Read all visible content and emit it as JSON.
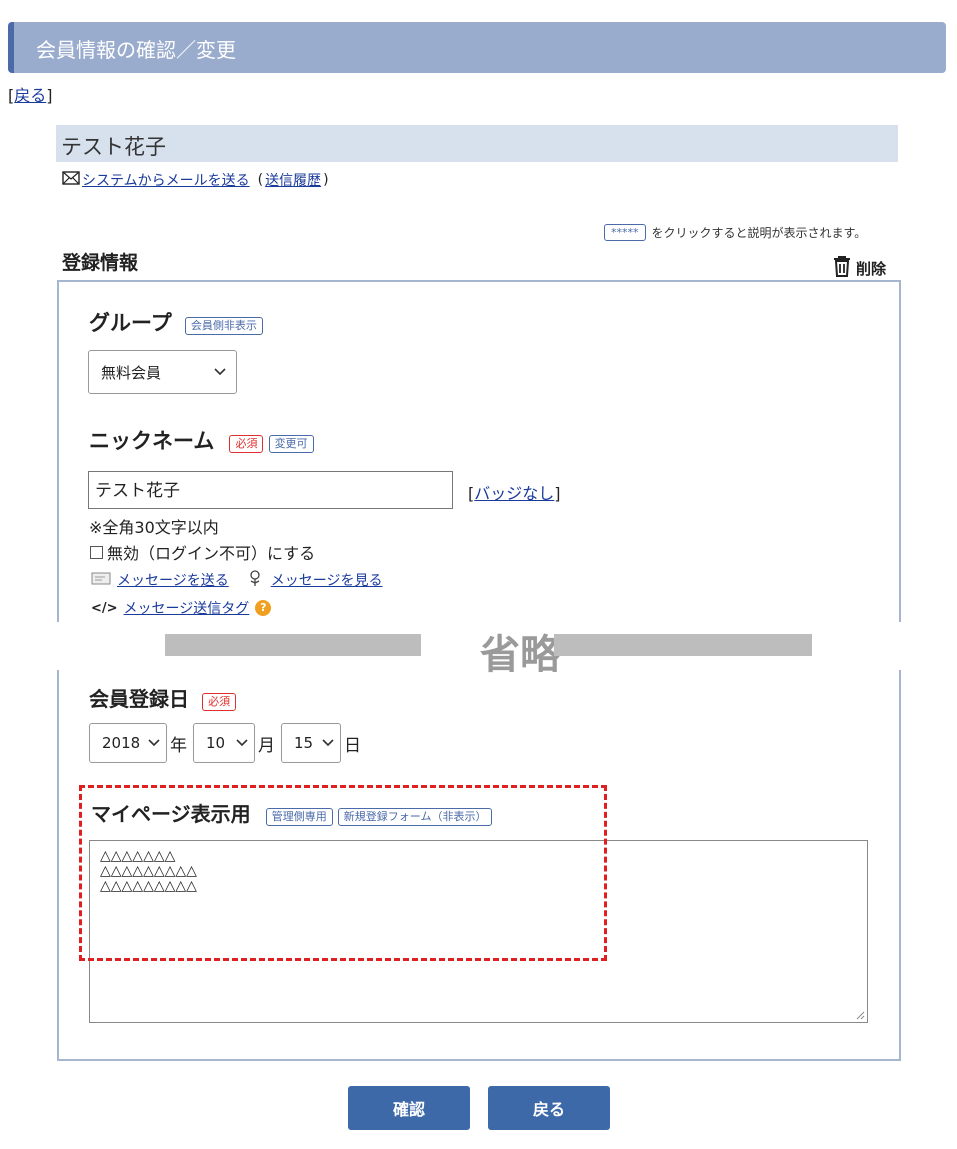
{
  "header": {
    "title": "会員情報の確認／変更"
  },
  "back_link": {
    "open": "[",
    "label": "戻る",
    "close": "]"
  },
  "member": {
    "name": "テスト花子",
    "send_mail_label": "システムからメールを送る",
    "history_open": "(",
    "history_label": "送信履歴",
    "history_close": ")"
  },
  "help": {
    "stars": "*****",
    "text": "をクリックすると説明が表示されます。"
  },
  "section": {
    "title": "登録情報",
    "delete_label": "削除"
  },
  "group": {
    "label": "グループ",
    "tag": "会員側非表示",
    "selected": "無料会員"
  },
  "nickname": {
    "label": "ニックネーム",
    "tag_required": "必須",
    "tag_editable": "変更可",
    "value": "テスト花子",
    "badge_open": "[",
    "badge_label": "バッジなし",
    "badge_close": "]",
    "note": "※全角30文字以内",
    "disable_label": "無効（ログイン不可）にする",
    "send_message": "メッセージを送る",
    "view_message": "メッセージを見る",
    "tag_code": "</>",
    "message_tag": "メッセージ送信タグ",
    "help_glyph": "?"
  },
  "omitted": "省略",
  "join_date": {
    "label": "会員登録日",
    "tag_required": "必須",
    "year": "2018",
    "year_unit": "年",
    "month": "10",
    "month_unit": "月",
    "day": "15",
    "day_unit": "日"
  },
  "mypage": {
    "label": "マイページ表示用",
    "tag_admin": "管理側専用",
    "tag_form": "新規登録フォーム（非表示）",
    "lines": [
      "△△△△△△△",
      "△△△△△△△△△",
      "△△△△△△△△△"
    ]
  },
  "buttons": {
    "confirm": "確認",
    "back": "戻る"
  },
  "colors": {
    "accent": "#3e69a9",
    "header": "#9aaccd",
    "required": "#e03030",
    "highlight": "#e02020"
  }
}
